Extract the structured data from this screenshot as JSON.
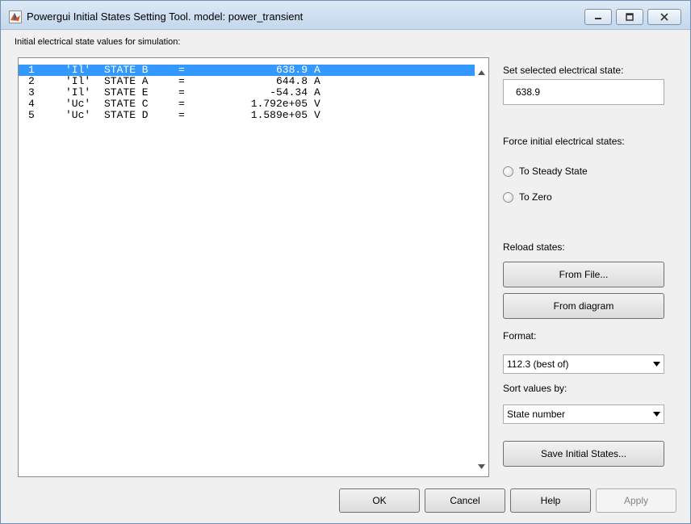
{
  "window": {
    "title": "Powergui Initial States Setting Tool.  model: power_transient"
  },
  "main": {
    "list_label": "Initial electrical state values for simulation:",
    "states": [
      {
        "index": "1",
        "name": "'Il'",
        "state": "STATE B",
        "eq": "=",
        "value": "638.9",
        "unit": "A",
        "selected": true
      },
      {
        "index": "2",
        "name": "'Il'",
        "state": "STATE A",
        "eq": "=",
        "value": "644.8",
        "unit": "A",
        "selected": false
      },
      {
        "index": "3",
        "name": "'Il'",
        "state": "STATE E",
        "eq": "=",
        "value": "-54.34",
        "unit": "A",
        "selected": false
      },
      {
        "index": "4",
        "name": "'Uc'",
        "state": "STATE C",
        "eq": "=",
        "value": "1.792e+05",
        "unit": "V",
        "selected": false
      },
      {
        "index": "5",
        "name": "'Uc'",
        "state": "STATE D",
        "eq": "=",
        "value": "1.589e+05",
        "unit": "V",
        "selected": false
      }
    ]
  },
  "side": {
    "set_label": "Set selected electrical state:",
    "set_value": "638.9",
    "force_label": "Force initial electrical states:",
    "radio_steady": "To Steady State",
    "radio_zero": "To Zero",
    "reload_label": "Reload states:",
    "from_file": "From File...",
    "from_diagram": "From diagram",
    "format_label": "Format:",
    "format_value": "112.3 (best of)",
    "sort_label": "Sort values by:",
    "sort_value": "State number",
    "save_button": "Save Initial States..."
  },
  "footer": {
    "ok": "OK",
    "cancel": "Cancel",
    "help": "Help",
    "apply": "Apply"
  },
  "colors": {
    "selection": "#3399ff",
    "window_bg": "#f0f0f0",
    "titlebar": "#c4d7ec"
  }
}
